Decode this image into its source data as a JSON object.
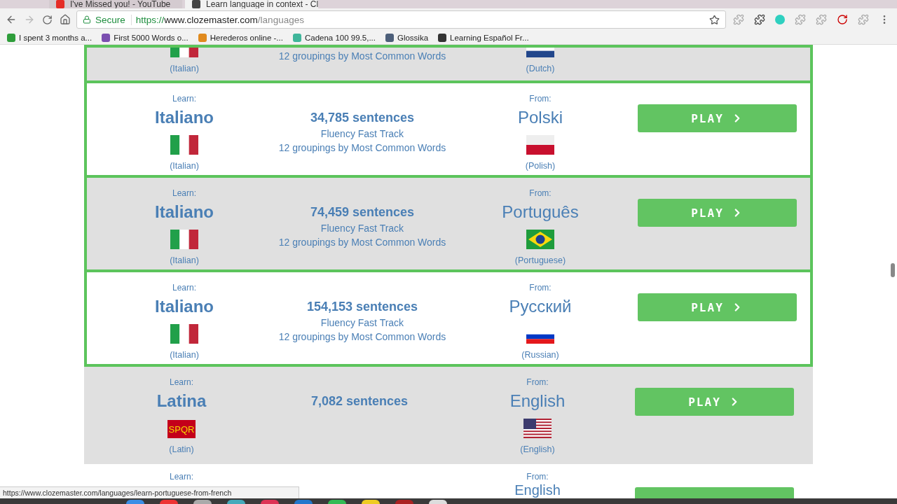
{
  "browser": {
    "tabs": [
      {
        "title": "I've Missed you! - YouTube",
        "selected": false
      },
      {
        "title": "Learn language in context - Cl",
        "selected": true
      }
    ],
    "address": {
      "secure_label": "Secure",
      "scheme": "https://",
      "host": "www.clozemaster.com",
      "path": "/languages"
    },
    "bookmarks": [
      {
        "label": "I spent 3 months a...",
        "color": "#2e9d3a"
      },
      {
        "label": "First 5000 Words o...",
        "color": "#7b4fb0"
      },
      {
        "label": "Herederos online -...",
        "color": "#e08a1e"
      },
      {
        "label": "Cadena 100 99.5,...",
        "color": "#3fb59a"
      },
      {
        "label": "Glossika",
        "color": "#4d5f7a"
      },
      {
        "label": "Learning Español Fr...",
        "color": "#333333"
      }
    ]
  },
  "rows": [
    {
      "kind": "tail",
      "highlighted": true,
      "shaded": true,
      "learn_flag": {
        "kind": "it"
      },
      "learn_native": "(Italian)",
      "groupings": "12 groupings by Most Common Words",
      "from_flag": {
        "kind": "nl"
      },
      "from_native": "(Dutch)"
    },
    {
      "kind": "full",
      "highlighted": true,
      "shaded": false,
      "learn_label": "Learn:",
      "learn_name": "Italiano",
      "learn_flag": {
        "kind": "it"
      },
      "learn_native": "(Italian)",
      "sentences": "34,785 sentences",
      "track": "Fluency Fast Track",
      "groupings": "12 groupings by Most Common Words",
      "from_label": "From:",
      "from_name": "Polski",
      "from_flag": {
        "kind": "pl"
      },
      "from_native": "(Polish)",
      "button": "PLAY"
    },
    {
      "kind": "full",
      "highlighted": true,
      "shaded": true,
      "learn_label": "Learn:",
      "learn_name": "Italiano",
      "learn_flag": {
        "kind": "it"
      },
      "learn_native": "(Italian)",
      "sentences": "74,459 sentences",
      "track": "Fluency Fast Track",
      "groupings": "12 groupings by Most Common Words",
      "from_label": "From:",
      "from_name": "Português",
      "from_flag": {
        "kind": "br"
      },
      "from_native": "(Portuguese)",
      "button": "PLAY"
    },
    {
      "kind": "full",
      "highlighted": true,
      "shaded": false,
      "learn_label": "Learn:",
      "learn_name": "Italiano",
      "learn_flag": {
        "kind": "it"
      },
      "learn_native": "(Italian)",
      "sentences": "154,153 sentences",
      "track": "Fluency Fast Track",
      "groupings": "12 groupings by Most Common Words",
      "from_label": "From:",
      "from_name": "Русский",
      "from_flag": {
        "kind": "ru"
      },
      "from_native": "(Russian)",
      "button": "PLAY"
    },
    {
      "kind": "full",
      "highlighted": false,
      "shaded": true,
      "learn_label": "Learn:",
      "learn_name": "Latina",
      "learn_flag": {
        "kind": "spqr",
        "text": "SPQR"
      },
      "learn_native": "(Latin)",
      "sentences": "7,082 sentences",
      "from_label": "From:",
      "from_name": "English",
      "from_flag": {
        "kind": "us"
      },
      "from_native": "(English)",
      "button": "PLAY"
    },
    {
      "kind": "head",
      "highlighted": false,
      "shaded": false,
      "learn_label": "Learn:",
      "from_label": "From:",
      "from_name": "English"
    }
  ],
  "status_url": "https://www.clozemaster.com/languages/learn-portuguese-from-french"
}
